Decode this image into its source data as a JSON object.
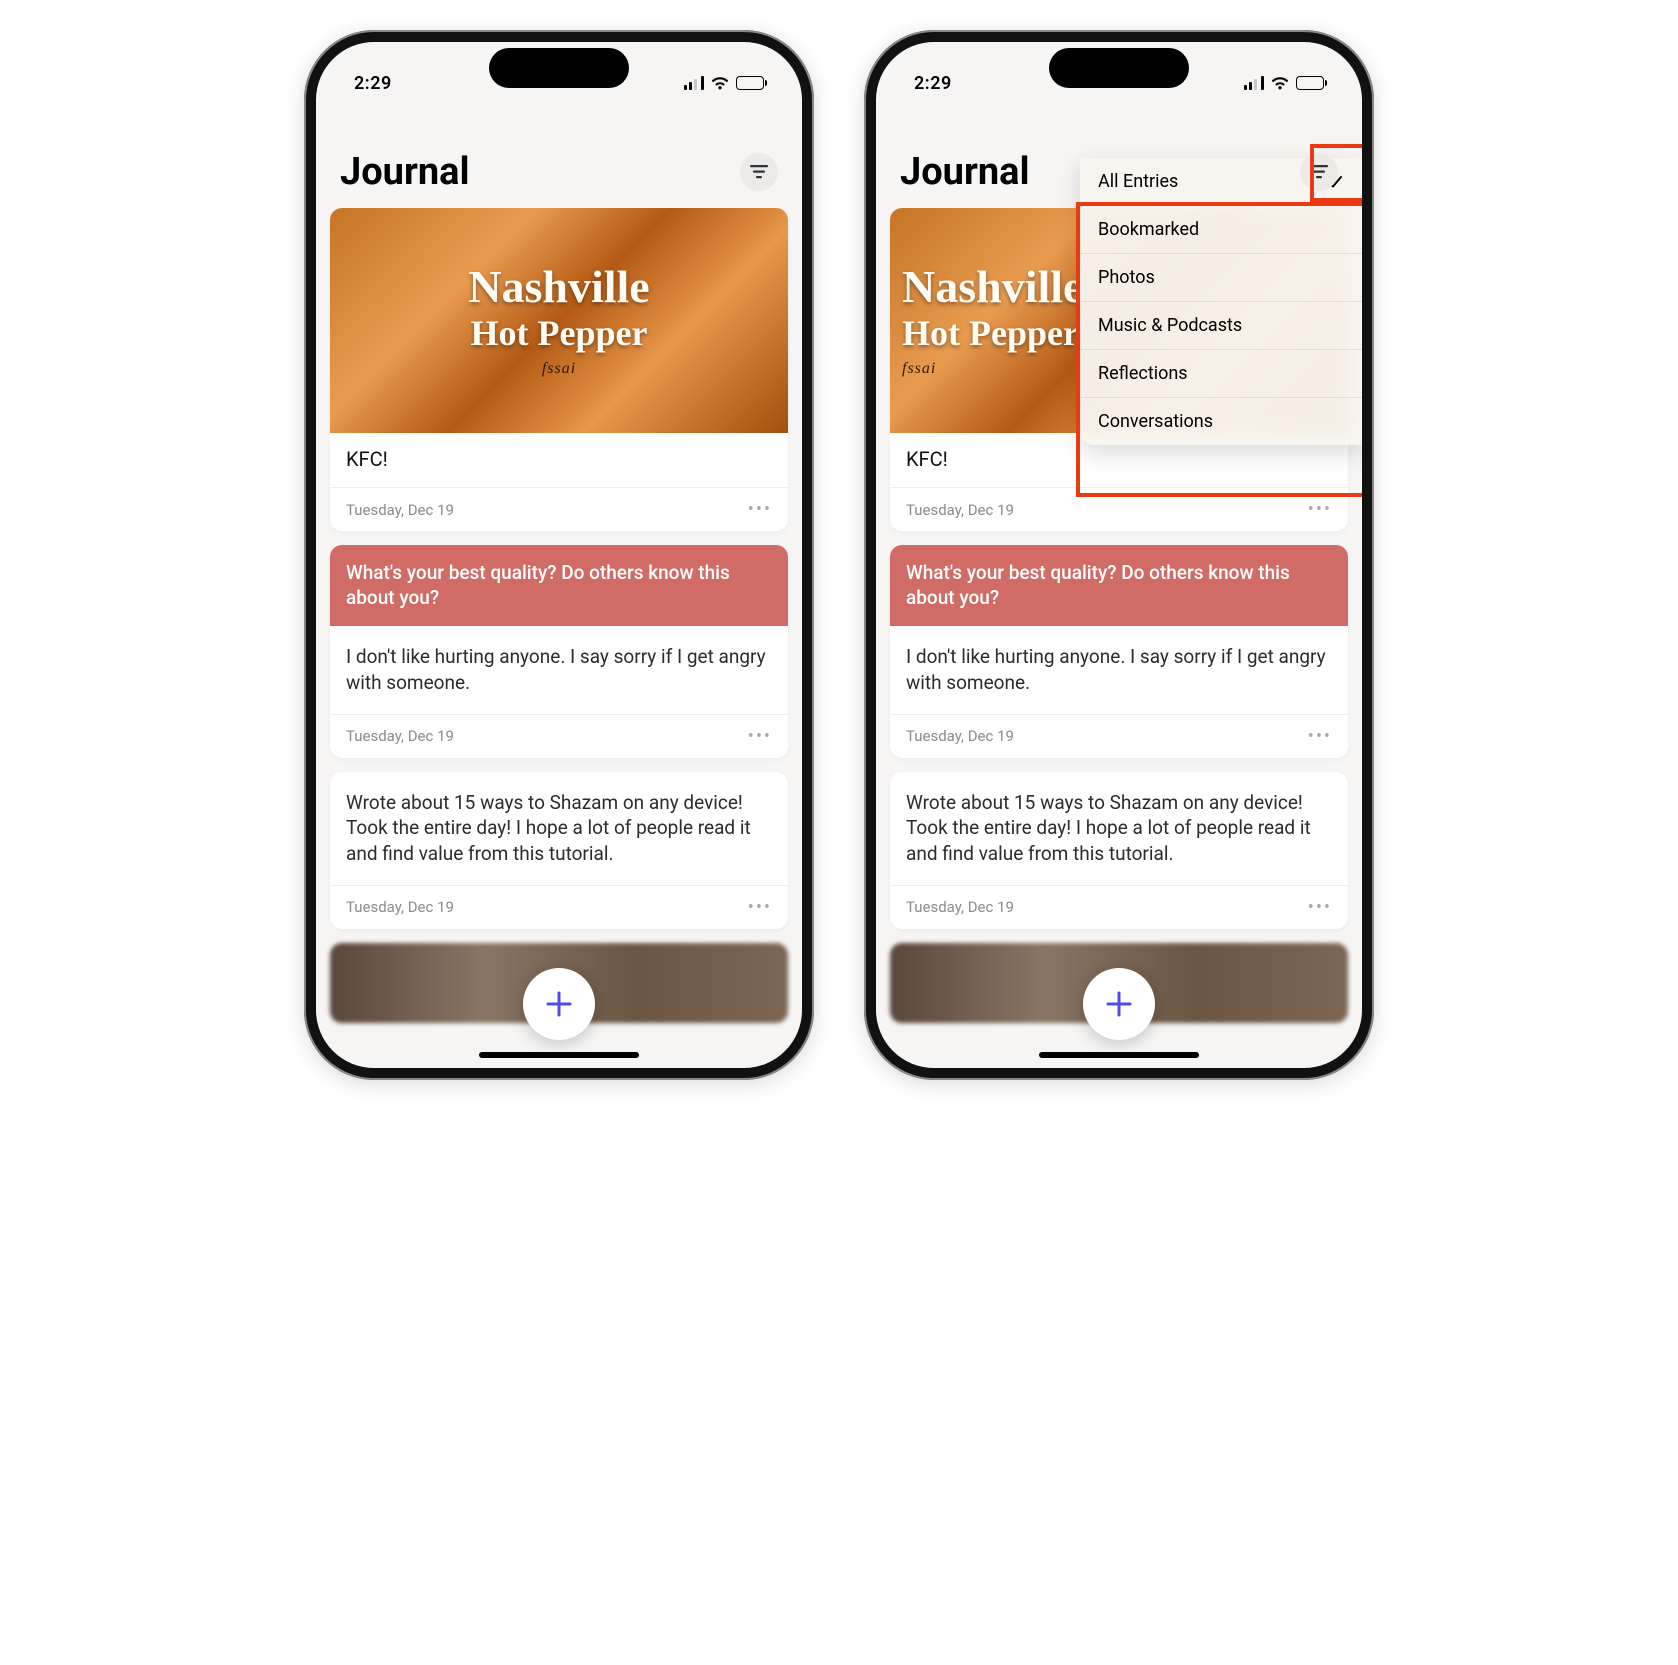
{
  "status": {
    "time": "2:29"
  },
  "header": {
    "title": "Journal"
  },
  "image_text": {
    "line1": "Nashville",
    "line2": "Hot Pepper",
    "mark": "fssai"
  },
  "entries": [
    {
      "title": "KFC!",
      "date": "Tuesday, Dec 19"
    },
    {
      "prompt": "What's your best quality? Do others know this about you?",
      "body": "I don't like hurting anyone. I say sorry if I get angry with someone.",
      "date": "Tuesday, Dec 19"
    },
    {
      "body": "Wrote about 15 ways to Shazam on any device! Took the entire day! I hope a lot of people read it and find value from this tutorial.",
      "date": "Tuesday, Dec 19"
    }
  ],
  "filter_menu": {
    "items": [
      {
        "label": "All Entries",
        "checked": true
      },
      {
        "label": "Bookmarked",
        "checked": false
      },
      {
        "label": "Photos",
        "checked": false
      },
      {
        "label": "Music & Podcasts",
        "checked": false
      },
      {
        "label": "Reflections",
        "checked": false
      },
      {
        "label": "Conversations",
        "checked": false
      }
    ]
  },
  "highlight_color": "#ea3a13"
}
